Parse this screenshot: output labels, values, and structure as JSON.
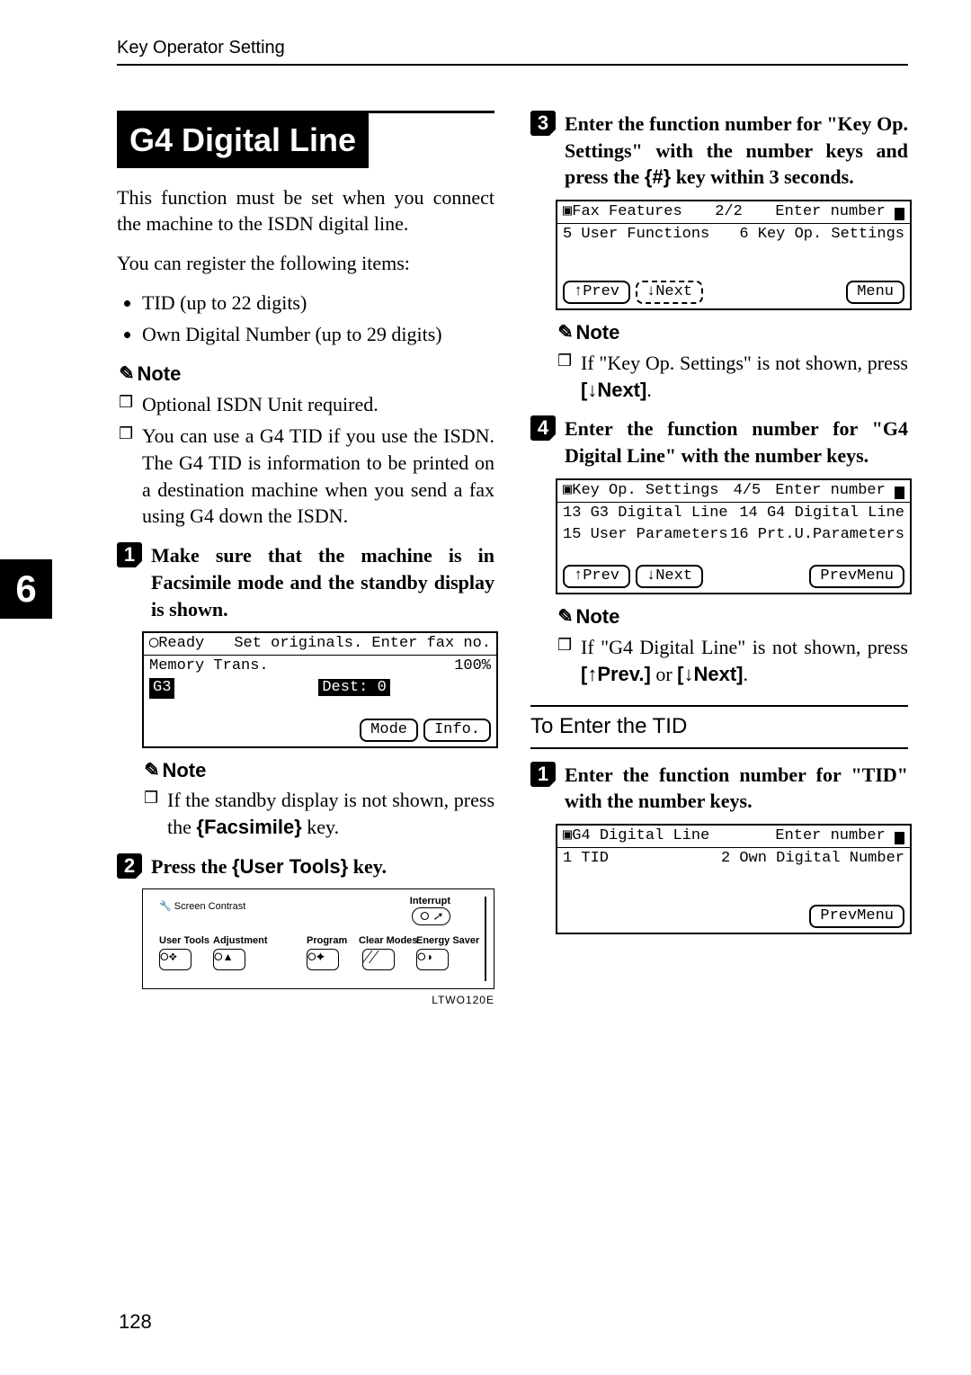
{
  "runningHead": "Key Operator Setting",
  "sideTab": "6",
  "pageNumber": "128",
  "section": {
    "title": "G4 Digital Line",
    "intro1": "This function must be set when you connect the machine to the ISDN digital line.",
    "intro2": "You can register the following items:",
    "bullets": [
      "TID (up to 22 digits)",
      "Own Digital Number (up to 29 digits)"
    ],
    "noteLabel": "Note",
    "notes1": [
      "Optional ISDN Unit required.",
      "You can use a G4 TID if you use the ISDN. The G4 TID is information to be printed on a destination machine when you send a fax using G4 down the ISDN."
    ],
    "step1": "Make sure that the machine is in Facsimile mode and the standby display is shown.",
    "note1b_line1": "If the standby display is not shown, press the ",
    "note1b_key": "{Facsimile}",
    "note1b_line2": " key.",
    "step2_pre": "Press the ",
    "step2_key": "{User Tools}",
    "step2_post": " key.",
    "panel": {
      "screenContrast": "Screen Contrast",
      "interrupt": "Interrupt",
      "userTools": "User Tools",
      "adjustment": "Adjustment",
      "program": "Program",
      "clearModes": "Clear Modes",
      "energySaver": "Energy Saver",
      "code": "LTWO120E"
    },
    "step3_a": "Enter the function number for \"Key Op. Settings\" with the number keys and press the ",
    "step3_key": "{#}",
    "step3_b": " key within 3 seconds.",
    "note2": "If \"Key Op. Settings\" is not shown, press ",
    "note2_key": "[↓Next]",
    "step4": "Enter the function number for \"G4 Digital Line\" with the number keys.",
    "note3_a": "If \"G4 Digital Line\" is not shown, press ",
    "note3_key1": "[↑Prev.]",
    "note3_mid": " or ",
    "note3_key2": "[↓Next]",
    "subhead": "To Enter the TID",
    "step5": "Enter the function number for \"TID\" with the number keys."
  },
  "lcd1": {
    "statusLeft": "◯Ready",
    "statusRight": "Set originals. Enter fax no.",
    "line2Left": "Memory Trans.",
    "line2Right": "100%",
    "line3Left": "G3",
    "line3Right": "Dest:  0",
    "btnMode": "Mode",
    "btnInfo": "Info."
  },
  "lcd2": {
    "titleLeft": "Fax Features",
    "titleMid": "2/2",
    "titleRight": "Enter number",
    "row2Left": "5 User Functions",
    "row2Right": "6 Key Op. Settings",
    "btnPrev": "↑Prev",
    "btnNext": "↓Next",
    "btnMenu": "Menu"
  },
  "lcd3": {
    "titleLeft": "Key Op. Settings",
    "titleMid": "4/5",
    "titleRight": "Enter number",
    "row2Left": "13 G3 Digital Line",
    "row2Right": "14 G4 Digital Line",
    "row3Left": "15 User Parameters",
    "row3Right": "16 Prt.U.Parameters",
    "btnPrev": "↑Prev",
    "btnNext": "↓Next",
    "btnMenu": "PrevMenu"
  },
  "lcd4": {
    "titleLeft": "G4 Digital Line",
    "titleRight": "Enter number",
    "row2Left": "1 TID",
    "row2Right": "2 Own Digital Number",
    "btnMenu": "PrevMenu"
  }
}
